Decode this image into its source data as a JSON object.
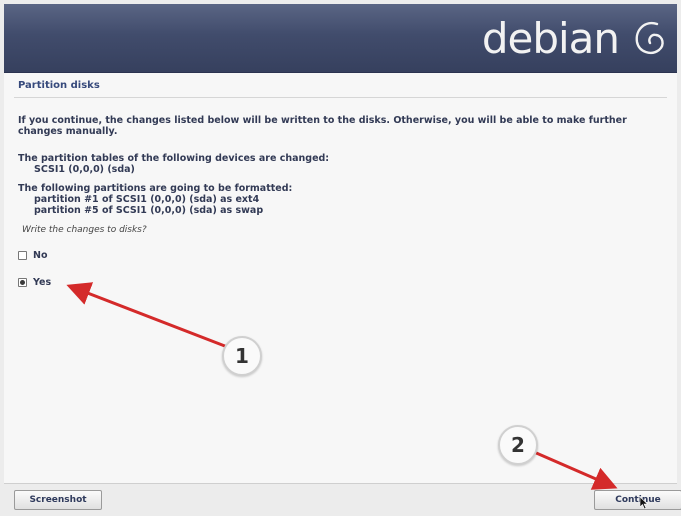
{
  "banner": {
    "logo_text": "debian",
    "logo_icon": "debian-swirl-icon"
  },
  "page": {
    "title": "Partition disks",
    "intro": "If you continue, the changes listed below will be written to the disks. Otherwise, you will be able to make further changes manually.",
    "tables_heading": "The partition tables of the following devices are changed:",
    "tables_device": "SCSI1 (0,0,0) (sda)",
    "format_heading": "The following partitions are going to be formatted:",
    "format_items": [
      "partition #1 of SCSI1 (0,0,0) (sda) as ext4",
      "partition #5 of SCSI1 (0,0,0) (sda) as swap"
    ],
    "question": "Write the changes to disks?",
    "options": [
      {
        "label": "No",
        "selected": false
      },
      {
        "label": "Yes",
        "selected": true
      }
    ]
  },
  "buttons": {
    "screenshot": "Screenshot",
    "continue": "Continue"
  },
  "annotations": {
    "marker1": "1",
    "marker2": "2",
    "arrow_color": "#d42a2a"
  },
  "colors": {
    "banner": "#414c6c",
    "heading_text": "#374a7c"
  }
}
